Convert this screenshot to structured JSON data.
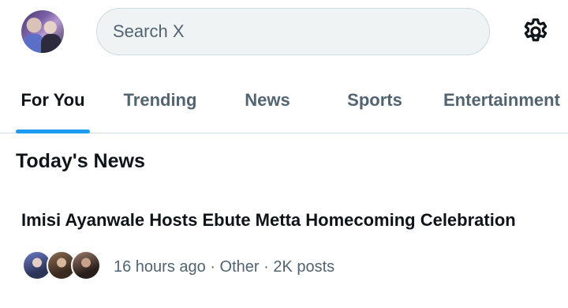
{
  "header": {
    "search_placeholder": "Search X",
    "avatar_icon": "user-avatar",
    "settings_icon": "gear-icon"
  },
  "tabs": [
    {
      "label": "For You",
      "active": true
    },
    {
      "label": "Trending",
      "active": false
    },
    {
      "label": "News",
      "active": false
    },
    {
      "label": "Sports",
      "active": false
    },
    {
      "label": "Entertainment",
      "active": false
    }
  ],
  "section": {
    "title": "Today's News"
  },
  "news": [
    {
      "headline": "Imisi Ayanwale Hosts Ebute Metta Homecoming Celebration",
      "time": "16 hours ago",
      "category": "Other",
      "posts": "2K posts",
      "separator": " · "
    }
  ],
  "colors": {
    "accent": "#1d9bf0",
    "text_primary": "#0f1419",
    "text_secondary": "#536471",
    "search_bg": "#eff3f4",
    "border": "#cfd9de"
  }
}
